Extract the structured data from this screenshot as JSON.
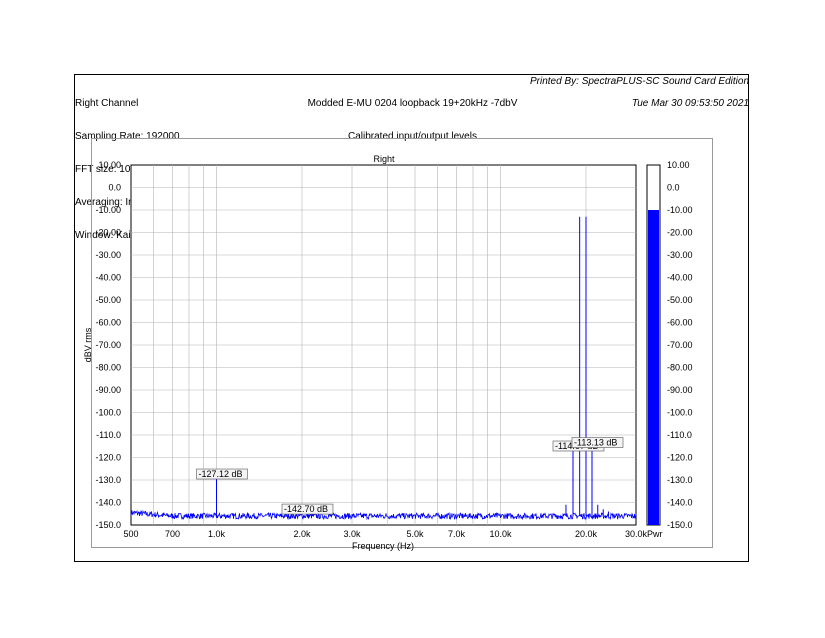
{
  "header": {
    "left_lines": [
      "Right Channel",
      "Sampling Rate: 192000",
      "FFT size: 1048576",
      "Averaging: Infinite",
      "Window: Kaiser"
    ],
    "center_lines": [
      "Modded E-MU 0204 loopback 19+20kHz -7dbV",
      "Calibrated input/output levels"
    ],
    "printed_by": "Printed By: SpectraPLUS-SC Sound Card Edition",
    "timestamp": "Tue Mar 30 09:53:50 2021"
  },
  "colors": {
    "trace": "#0000ff",
    "grid": "#b4b4b4",
    "meter_fill": "#0000ff"
  },
  "chart_data": {
    "type": "line",
    "title": "Right",
    "xlabel": "Frequency (Hz)",
    "ylabel": "dBV rms",
    "x_scale": "log",
    "xlim": [
      500,
      30000
    ],
    "ylim": [
      -150,
      10
    ],
    "grid": true,
    "x_ticks": [
      500,
      700,
      1000,
      2000,
      3000,
      5000,
      7000,
      10000,
      20000,
      30000
    ],
    "x_tick_labels": [
      "500",
      "700",
      "1.0k",
      "2.0k",
      "3.0k",
      "5.0k",
      "7.0k",
      "10.0k",
      "20.0k",
      "30.0k"
    ],
    "y_ticks": [
      10,
      0,
      -10,
      -20,
      -30,
      -40,
      -50,
      -60,
      -70,
      -80,
      -90,
      -100,
      -110,
      -120,
      -130,
      -140,
      -150
    ],
    "y_tick_labels": [
      "10.00",
      "0.0",
      "-10.00",
      "-20.00",
      "-30.00",
      "-40.00",
      "-50.00",
      "-60.00",
      "-70.00",
      "-80.00",
      "-90.00",
      "-100.0",
      "-110.0",
      "-120.0",
      "-130.0",
      "-140.0",
      "-150.0"
    ],
    "noise_floor_dbv": -146,
    "peaks": [
      {
        "freq": 1000,
        "level": -127.12
      },
      {
        "freq": 2000,
        "level": -142.7
      },
      {
        "freq": 17000,
        "level": -141
      },
      {
        "freq": 18000,
        "level": -114.67
      },
      {
        "freq": 19000,
        "level": -13
      },
      {
        "freq": 20000,
        "level": -13
      },
      {
        "freq": 21000,
        "level": -113.13
      },
      {
        "freq": 22000,
        "level": -141
      },
      {
        "freq": 23000,
        "level": -143
      },
      {
        "freq": 24000,
        "level": -144
      }
    ],
    "annotations": [
      {
        "text": "-127.12 dB",
        "freq": 1000,
        "level": -127.12
      },
      {
        "text": "-142.70 dB",
        "freq": 2000,
        "level": -142.7
      },
      {
        "text": "-114.67 dB",
        "freq": 18000,
        "level": -114.67
      },
      {
        "text": "-113.13 dB",
        "freq": 21000,
        "level": -113.13
      }
    ],
    "meter": {
      "label": "Pwr",
      "level": -10,
      "ticks": [
        "10.00",
        "0.0",
        "-10.00",
        "-20.00",
        "-30.00",
        "-40.00",
        "-50.00",
        "-60.00",
        "-70.00",
        "-80.00",
        "-90.00",
        "-100.0",
        "-110.0",
        "-120.0",
        "-130.0",
        "-140.0",
        "-150.0"
      ]
    }
  }
}
